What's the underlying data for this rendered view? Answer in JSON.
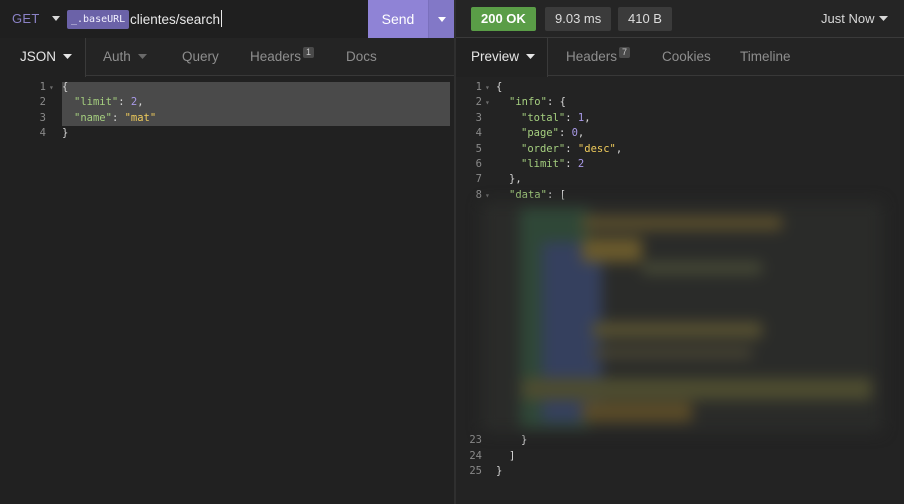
{
  "request": {
    "method": "GET",
    "base_url_tag": "_.baseURL",
    "url_path": "clientes/search",
    "send_label": "Send"
  },
  "response_meta": {
    "status": "200 OK",
    "time": "9.03 ms",
    "size": "410 B",
    "history": "Just Now"
  },
  "left_tabs": [
    {
      "label": "JSON"
    },
    {
      "label": "Auth"
    },
    {
      "label": "Query"
    },
    {
      "label": "Headers",
      "badge": "1"
    },
    {
      "label": "Docs"
    }
  ],
  "right_tabs": [
    {
      "label": "Preview"
    },
    {
      "label": "Headers",
      "badge": "7"
    },
    {
      "label": "Cookies"
    },
    {
      "label": "Timeline"
    }
  ],
  "request_body": {
    "line_numbers": [
      "1",
      "2",
      "3",
      "4"
    ],
    "lines": [
      {
        "open": "{"
      },
      {
        "key": "\"limit\"",
        "value": "2",
        "value_type": "num",
        "trail": ","
      },
      {
        "key": "\"name\"",
        "value": "\"mat\"",
        "value_type": "str",
        "trail": ""
      },
      {
        "close": "}"
      }
    ]
  },
  "response_body": {
    "line_numbers": [
      "1",
      "2",
      "3",
      "4",
      "5",
      "6",
      "7",
      "8",
      "23",
      "24",
      "25"
    ],
    "lines": [
      {
        "open": "{"
      },
      {
        "key": "\"info\"",
        "after": ": {"
      },
      {
        "key": "\"total\"",
        "value": "1",
        "value_type": "num",
        "trail": ","
      },
      {
        "key": "\"page\"",
        "value": "0",
        "value_type": "num",
        "trail": ","
      },
      {
        "key": "\"order\"",
        "value": "\"desc\"",
        "value_type": "str",
        "trail": ","
      },
      {
        "key": "\"limit\"",
        "value": "2",
        "value_type": "num",
        "trail": ""
      },
      {
        "close": "},"
      },
      {
        "key": "\"data\"",
        "after": ": ["
      },
      {
        "close": "}"
      },
      {
        "close": "]"
      },
      {
        "close": "}"
      }
    ]
  },
  "colors": {
    "accent": "#8f83d6",
    "status_ok": "#5a9d47",
    "json_key": "#a5cf7f",
    "json_string": "#f0cc5c",
    "json_number": "#a99ae8"
  },
  "icons": {
    "method_dropdown": "caret-down-icon",
    "send_dropdown": "caret-down-icon",
    "fold_marker": "fold-arrow-icon"
  }
}
